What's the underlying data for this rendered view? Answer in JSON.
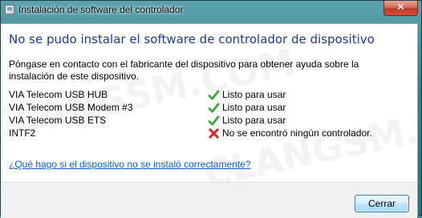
{
  "window": {
    "title": "Instalación de software del controlador",
    "close_glyph": "✕",
    "watermark": "CLANGSM.COM"
  },
  "dialog": {
    "heading": "No se pudo instalar el software de controlador de dispositivo",
    "description": "Póngase en contacto con el fabricante del dispositivo para obtener ayuda sobre la instalación de este dispositivo.",
    "devices": [
      {
        "name": "VIA Telecom USB HUB",
        "status": "Listo para usar",
        "icon": "check-icon",
        "color": "#3ea73a"
      },
      {
        "name": "VIA Telecom USB Modem #3",
        "status": "Listo para usar",
        "icon": "check-icon",
        "color": "#3ea73a"
      },
      {
        "name": "VIA Telecom USB ETS",
        "status": "Listo para usar",
        "icon": "check-icon",
        "color": "#3ea73a"
      },
      {
        "name": "INTF2",
        "status": "No se encontró ningún controlador.",
        "icon": "error-x-icon",
        "color": "#d42a2a"
      }
    ],
    "help_link": "¿Qué hago si el dispositivo no se instaló correctamente?",
    "close_button": "Cerrar"
  },
  "colors": {
    "heading": "#1c3c8f",
    "link": "#0b5bd3",
    "titlebar": "#3b7f8b"
  }
}
